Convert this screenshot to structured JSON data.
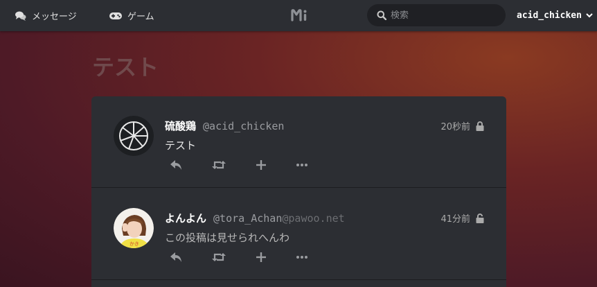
{
  "header": {
    "messages_label": "メッセージ",
    "messages_icon": "comments-icon",
    "games_label": "ゲーム",
    "games_icon": "gamepad-icon",
    "logo_text": "Mi",
    "search_placeholder": "検索",
    "account_name": "acid_chicken"
  },
  "page": {
    "title": "テスト"
  },
  "timeline": {
    "posts": [
      {
        "display_name": "硫酸鶏",
        "username": "@acid_chicken",
        "host": "",
        "time": "20秒前",
        "visibility_icon": "lock-icon",
        "text": "テスト"
      },
      {
        "display_name": "よんよん",
        "username": "@tora_Achan",
        "host": "@pawoo.net",
        "time": "41分前",
        "visibility_icon": "unlock-icon",
        "text": "この投稿は見せられへんわ"
      }
    ],
    "action_icons": [
      "reply-icon",
      "renote-icon",
      "reaction-add-icon",
      "more-icon"
    ]
  },
  "colors": {
    "bar": "#2c2e33",
    "card": "#2c2e33",
    "background": "#5a1e26"
  }
}
